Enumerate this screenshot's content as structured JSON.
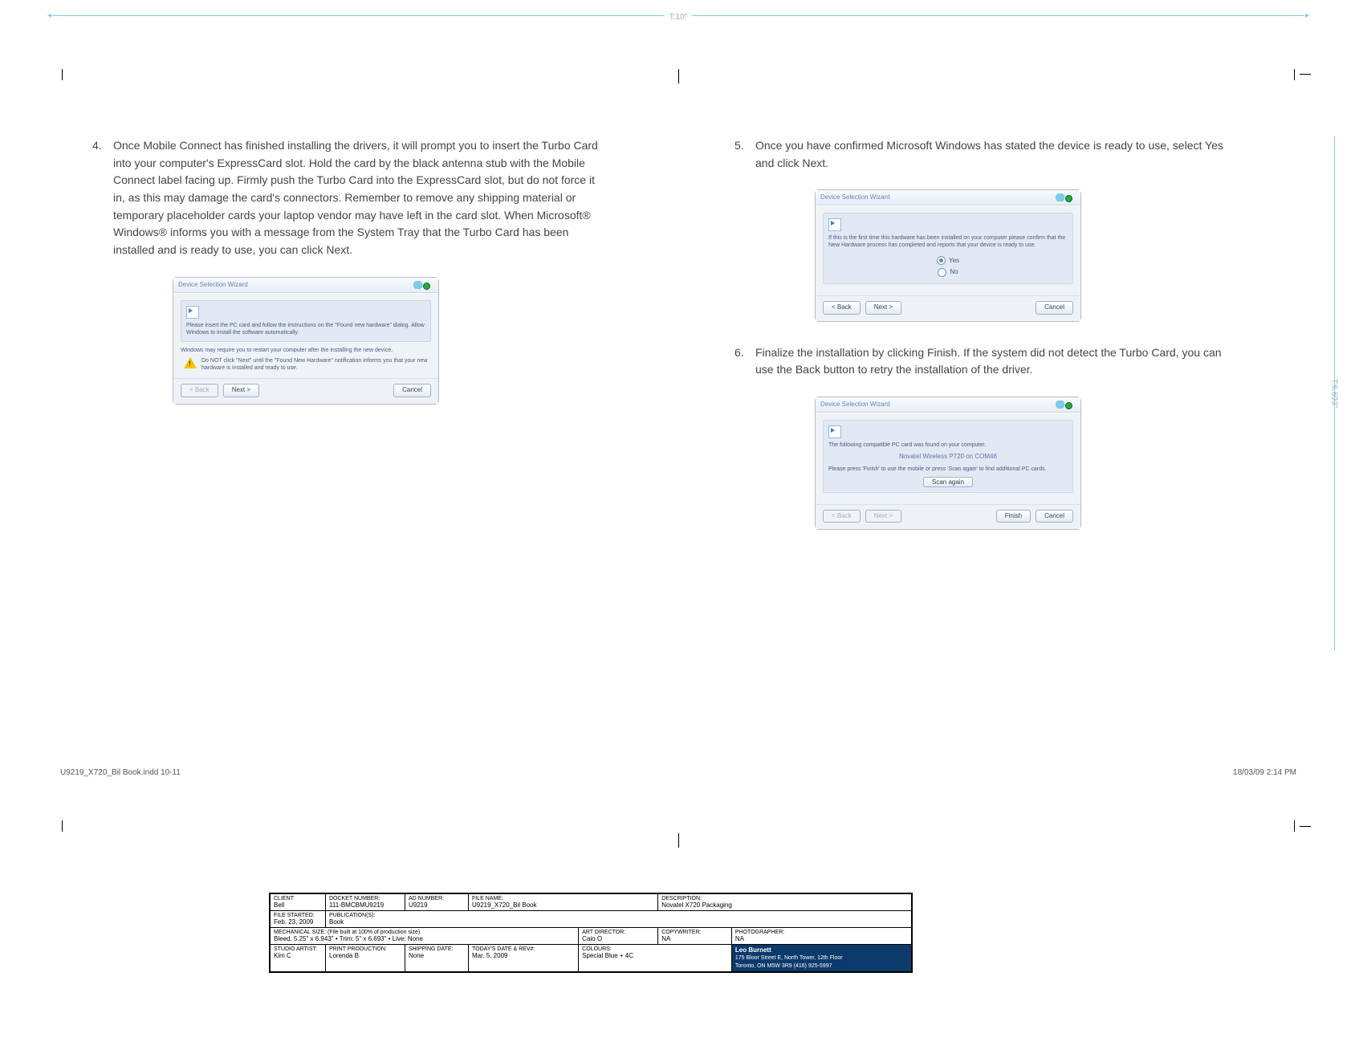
{
  "trim": {
    "width_label": "T:10\"",
    "height_label": "T:6.693\""
  },
  "steps": {
    "s4": {
      "num": "4.",
      "text": "Once Mobile Connect has finished installing the drivers, it will prompt you to insert the Turbo Card into your computer's ExpressCard slot. Hold the card by the black antenna stub with the Mobile Connect label facing up. Firmly push the Turbo Card into the ExpressCard slot, but do not force it in, as this may damage the card's connectors. Remember to remove any shipping material or temporary placeholder cards your laptop vendor may have left in the card slot. When Microsoft® Windows® informs you with a message from the System Tray that the Turbo Card has been installed and is ready to use, you can click Next."
    },
    "s5": {
      "num": "5.",
      "text": "Once you have confirmed Microsoft Windows has stated the device is ready to use, select Yes and click Next."
    },
    "s6": {
      "num": "6.",
      "text": "Finalize the installation by clicking Finish. If the system did not detect the Turbo Card, you can use the Back button to retry the installation of the driver."
    }
  },
  "wizard": {
    "title": "Device Selection Wizard",
    "a": {
      "line1": "Please insert the PC card and follow the instructions on the \"Found new hardware\" dialog. Allow Windows to install the software automatically.",
      "line2": "Windows may require you to restart your computer after the installing the new device.",
      "warn": "Do NOT click \"Next\" until the \"Found New Hardware\" notification informs you that your new hardware is installed and ready to use."
    },
    "b": {
      "line1": "If this is the first time this hardware has been installed on your computer please confirm that the New Hardware process has completed and reports that your device is ready to use.",
      "yes": "Yes",
      "no": "No"
    },
    "c": {
      "line1": "The following compatible PC card was found on your computer.",
      "device": "Novatel Wireless P720 on COM46",
      "line2": "Please press 'Finish' to use the mobile or press 'Scan again' to find additional PC cards.",
      "scan": "Scan again"
    },
    "buttons": {
      "back": "< Back",
      "next": "Next >",
      "finish": "Finish",
      "cancel": "Cancel"
    }
  },
  "footer": {
    "file_tag": "U9219_X720_Bil Book.indd   10-11",
    "stamp": "18/03/09   2:14 PM"
  },
  "slug": {
    "client": {
      "label": "CLIENT:",
      "value": "Bell"
    },
    "docket": {
      "label": "DOCKET NUMBER:",
      "value": "111-BMCBMU9219"
    },
    "ad": {
      "label": "AD NUMBER:",
      "value": "U9219"
    },
    "file": {
      "label": "FILE NAME:",
      "value": "U9219_X720_Bil Book"
    },
    "desc": {
      "label": "DESCRIPTION:",
      "value": "Novatel X720 Packaging"
    },
    "started": {
      "label": "FILE STARTED:",
      "value": "Feb. 23, 2009"
    },
    "pub": {
      "label": "PUBLICATION(S):",
      "value": "Book"
    },
    "mech": {
      "label": "MECHANICAL SIZE:",
      "value": "(File built at 100% of production size)",
      "value2": "Bleed:  5.25\" x 6.943\"  •   Trim:  5\" x 6.693\"  •   Live: None"
    },
    "artdir": {
      "label": "ART DIRECTOR:",
      "value": "Caio O"
    },
    "copy": {
      "label": "COPYWRITER:",
      "value": "NA"
    },
    "photo": {
      "label": "PHOTOGRAPHER:",
      "value": "NA"
    },
    "studio": {
      "label": "STUDIO ARTIST:",
      "value": "Kim C"
    },
    "print": {
      "label": "PRINT PRODUCTION:",
      "value": "Lorenda B"
    },
    "ship": {
      "label": "SHIPPING DATE:",
      "value": "None"
    },
    "today": {
      "label": "TODAY'S DATE & REV#:",
      "value": "Mar. 5, 2009"
    },
    "colours": {
      "label": "COLOURS:",
      "value": "Special Blue + 4C"
    },
    "agency": {
      "name": "Leo Burnett",
      "addr": "175 Bloor Street E, North Tower, 12th Floor",
      "city": "Toronto, ON M5W 3R9   (416) 925-5997"
    }
  }
}
